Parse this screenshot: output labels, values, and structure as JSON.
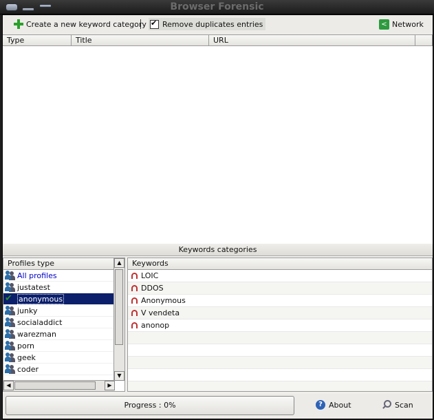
{
  "window": {
    "title": "Browser Forensic"
  },
  "toolbar": {
    "create_label": "Create a new keyword category",
    "remove_duplicates_label": "Remove duplicates entries",
    "remove_duplicates_checked": true,
    "network_label": "Network"
  },
  "results": {
    "columns": [
      "Type",
      "Title",
      "URL"
    ]
  },
  "keywords_categories_label": "Keywords categories",
  "profiles": {
    "header": "Profiles type",
    "items": [
      {
        "label": "All profiles",
        "icon": "users-icon"
      },
      {
        "label": "justatest",
        "icon": "users-icon"
      },
      {
        "label": "anonymous",
        "icon": "check-icon",
        "selected": true
      },
      {
        "label": "junky",
        "icon": "users-icon"
      },
      {
        "label": "socialaddict",
        "icon": "users-icon"
      },
      {
        "label": "warezman",
        "icon": "users-icon"
      },
      {
        "label": "porn",
        "icon": "users-icon"
      },
      {
        "label": "geek",
        "icon": "users-icon"
      },
      {
        "label": "coder",
        "icon": "users-icon"
      }
    ]
  },
  "keywords": {
    "header": "Keywords",
    "items": [
      "LOIC",
      "DDOS",
      "Anonymous",
      "V vendeta",
      "anonop"
    ]
  },
  "status": {
    "progress_label": "Progress : 0%",
    "progress_value": 0,
    "about_label": "About",
    "scan_label": "Scan"
  }
}
